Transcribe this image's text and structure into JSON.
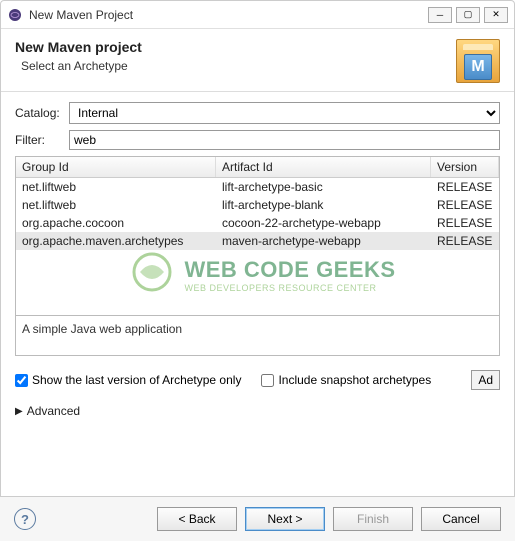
{
  "window": {
    "title": "New Maven Project"
  },
  "header": {
    "title": "New Maven project",
    "subtitle": "Select an Archetype",
    "icon_letter": "M"
  },
  "form": {
    "catalog_label": "Catalog:",
    "catalog_value": "Internal",
    "filter_label": "Filter:",
    "filter_value": "web"
  },
  "table": {
    "columns": [
      "Group Id",
      "Artifact Id",
      "Version"
    ],
    "rows": [
      {
        "group": "net.liftweb",
        "artifact": "lift-archetype-basic",
        "version": "RELEASE",
        "selected": false
      },
      {
        "group": "net.liftweb",
        "artifact": "lift-archetype-blank",
        "version": "RELEASE",
        "selected": false
      },
      {
        "group": "org.apache.cocoon",
        "artifact": "cocoon-22-archetype-webapp",
        "version": "RELEASE",
        "selected": false
      },
      {
        "group": "org.apache.maven.archetypes",
        "artifact": "maven-archetype-webapp",
        "version": "RELEASE",
        "selected": true
      }
    ]
  },
  "description": "A simple Java web application",
  "options": {
    "show_last_label": "Show the last version of Archetype only",
    "show_last_checked": true,
    "include_snapshot_label": "Include snapshot archetypes",
    "include_snapshot_checked": false,
    "add_label": "Ad"
  },
  "advanced_label": "Advanced",
  "buttons": {
    "back": "< Back",
    "next": "Next >",
    "finish": "Finish",
    "cancel": "Cancel"
  },
  "watermark": {
    "main": "WEB CODE GEEKS",
    "sub": "WEB DEVELOPERS RESOURCE CENTER"
  }
}
